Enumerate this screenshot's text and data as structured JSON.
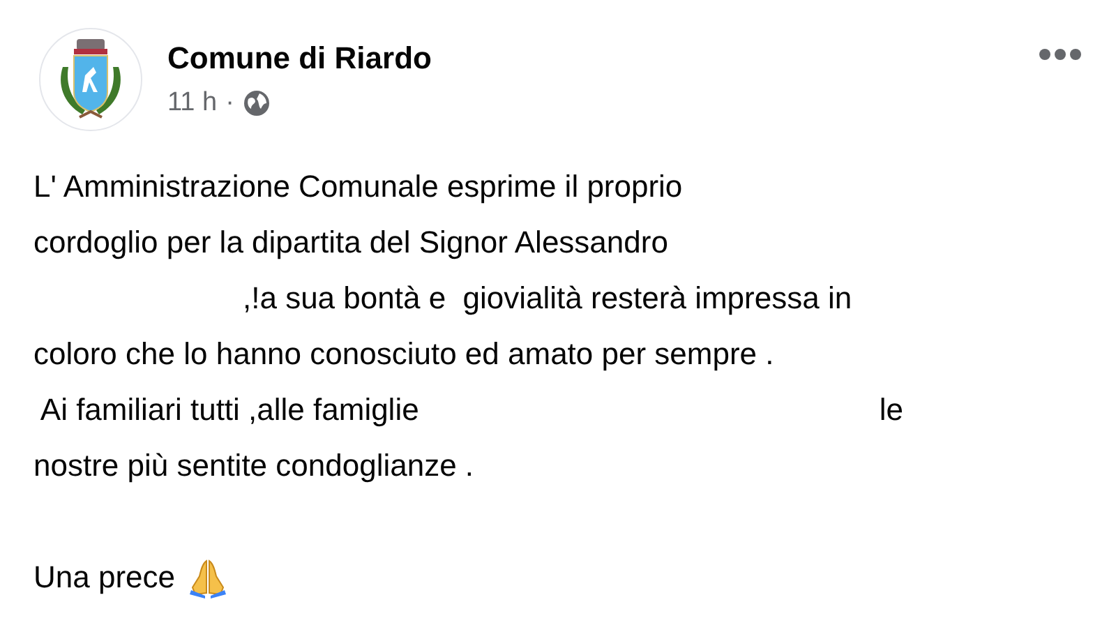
{
  "post": {
    "author": "Comune di Riardo",
    "time": "11 h",
    "separator": "·",
    "paragraphs": [
      [
        [
          {
            "kind": "text",
            "text": "L' Amministrazione Comunale esprime il proprio"
          }
        ],
        [
          {
            "kind": "text",
            "text": "cordoglio per la dipartita del Signor Alessandro"
          }
        ],
        [
          {
            "kind": "hidden_short"
          },
          {
            "kind": "text",
            "text": ",!a sua bontà e  giovialità resterà impressa in"
          }
        ],
        [
          {
            "kind": "text",
            "text": "coloro che lo hanno conosciuto ed amato per sempre ."
          }
        ],
        [
          {
            "kind": "text",
            "text": " Ai familiari tutti ,alle famiglie"
          },
          {
            "kind": "hidden_long"
          },
          {
            "kind": "text",
            "text": "le"
          }
        ],
        [
          {
            "kind": "text",
            "text": "nostre più sentite condoglianze ."
          }
        ]
      ],
      [
        [
          {
            "kind": "text",
            "text": "Una prece"
          },
          {
            "kind": "pray"
          }
        ]
      ]
    ]
  }
}
